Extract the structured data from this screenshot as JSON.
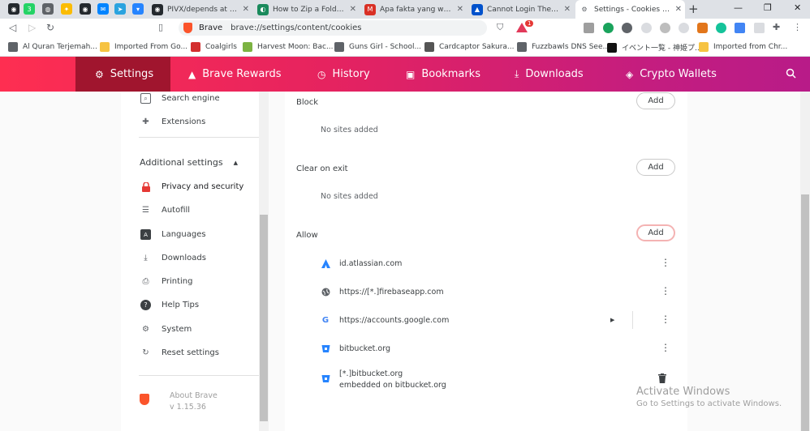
{
  "tabs": {
    "pinned": [
      {
        "icon": "github-icon",
        "color": "#24292e",
        "glyph": "◉"
      },
      {
        "icon": "whatsapp-icon",
        "color": "#25d366",
        "glyph": "3"
      },
      {
        "icon": "chrome-icon",
        "color": "#5f6368",
        "glyph": "◍"
      },
      {
        "icon": "bulb-icon",
        "color": "#fbbc04",
        "glyph": "✦"
      },
      {
        "icon": "github-icon",
        "color": "#24292e",
        "glyph": "◉"
      },
      {
        "icon": "messenger-icon",
        "color": "#0084ff",
        "glyph": "✉"
      },
      {
        "icon": "telegram-icon",
        "color": "#2aa3df",
        "glyph": "➤"
      },
      {
        "icon": "bitbucket-icon",
        "color": "#2684ff",
        "glyph": "▾"
      }
    ],
    "items": [
      {
        "label": "PIVX/depends at master",
        "icon": "github-icon",
        "color": "#24292e",
        "glyph": "◉"
      },
      {
        "label": "How to Zip a Folder in Linux",
        "icon": "site-icon",
        "color": "#1a8a5c",
        "glyph": "◐"
      },
      {
        "label": "Apa fakta yang wajib diketahui",
        "icon": "gmail-icon",
        "color": "#d93025",
        "glyph": "M"
      },
      {
        "label": "Cannot Login The Account",
        "icon": "atlassian-icon",
        "color": "#0052cc",
        "glyph": "▲"
      },
      {
        "label": "Settings - Cookies and site data",
        "icon": "gear-icon",
        "color": "#5f6368",
        "glyph": "⚙"
      }
    ]
  },
  "toolbar": {
    "brand": "Brave",
    "url": "brave://settings/content/cookies",
    "badge": "1"
  },
  "bookmarks": [
    {
      "label": "Al Quran Terjemah...",
      "color": "#5f6368"
    },
    {
      "label": "Imported From Go...",
      "color": "#f6c342"
    },
    {
      "label": "Coalgirls",
      "color": "#d32f2f"
    },
    {
      "label": "Harvest Moon: Bac...",
      "color": "#7cb342"
    },
    {
      "label": "Guns Girl - School...",
      "color": "#5f6368"
    },
    {
      "label": "Cardcaptor Sakura...",
      "color": "#555555"
    },
    {
      "label": "Fuzzbawls DNS See...",
      "color": "#5f6368"
    },
    {
      "label": "イベント一覧 - 神姫プ...",
      "color": "#111111"
    },
    {
      "label": "Imported from Chr...",
      "color": "#f6c342"
    }
  ],
  "nav": {
    "items": [
      {
        "label": "Settings",
        "icon": "gear-icon",
        "glyph": "⚙"
      },
      {
        "label": "Brave Rewards",
        "icon": "rewards-icon",
        "glyph": "▲"
      },
      {
        "label": "History",
        "icon": "history-icon",
        "glyph": "◷"
      },
      {
        "label": "Bookmarks",
        "icon": "bookmark-icon",
        "glyph": "▣"
      },
      {
        "label": "Downloads",
        "icon": "download-icon",
        "glyph": "⤓"
      },
      {
        "label": "Crypto Wallets",
        "icon": "wallet-icon",
        "glyph": "◈"
      }
    ]
  },
  "sidebar": {
    "items_top": [
      {
        "label": "Search engine",
        "icon": "search-engine-icon",
        "glyph": "⌕"
      },
      {
        "label": "Extensions",
        "icon": "puzzle-icon",
        "glyph": "✚"
      }
    ],
    "additional": "Additional settings",
    "items": [
      {
        "label": "Privacy and security",
        "icon": "lock-icon",
        "glyph": "🔒"
      },
      {
        "label": "Autofill",
        "icon": "list-icon",
        "glyph": "☰"
      },
      {
        "label": "Languages",
        "icon": "language-icon",
        "glyph": "A"
      },
      {
        "label": "Downloads",
        "icon": "download-icon",
        "glyph": "⤓"
      },
      {
        "label": "Printing",
        "icon": "printer-icon",
        "glyph": "⎙"
      },
      {
        "label": "Help Tips",
        "icon": "help-icon",
        "glyph": "?"
      },
      {
        "label": "System",
        "icon": "wrench-icon",
        "glyph": "⚙"
      },
      {
        "label": "Reset settings",
        "icon": "reset-icon",
        "glyph": "↻"
      }
    ],
    "about_title": "About Brave",
    "about_version": "v 1.15.36"
  },
  "cookies": {
    "block": {
      "title": "Block",
      "empty": "No sites added"
    },
    "clear": {
      "title": "Clear on exit",
      "empty": "No sites added"
    },
    "allow": {
      "title": "Allow",
      "sites": [
        {
          "label": "id.atlassian.com",
          "sub": "",
          "icon": "atlassian-icon"
        },
        {
          "label": "https://[*.]firebaseapp.com",
          "sub": "",
          "icon": "globe-icon"
        },
        {
          "label": "https://accounts.google.com",
          "sub": "",
          "icon": "google-icon"
        },
        {
          "label": "bitbucket.org",
          "sub": "",
          "icon": "bitbucket-icon"
        },
        {
          "label": "[*.]bitbucket.org",
          "sub": "embedded on bitbucket.org",
          "icon": "bitbucket-icon"
        }
      ]
    },
    "add_label": "Add"
  },
  "watermark": {
    "line1": "Activate Windows",
    "line2": "Go to Settings to activate Windows."
  },
  "colors": {
    "brave_orange": "#fb542b",
    "nav_gradient_start": "#fe2e51",
    "nav_gradient_end": "#b81b88"
  }
}
